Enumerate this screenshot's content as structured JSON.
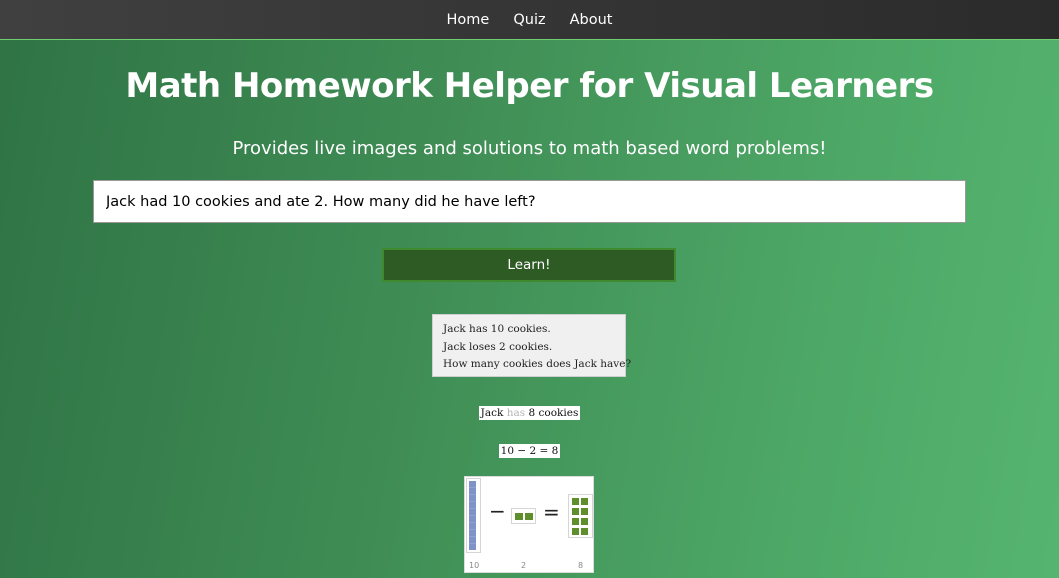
{
  "nav": {
    "items": [
      {
        "label": "Home"
      },
      {
        "label": "Quiz"
      },
      {
        "label": "About"
      }
    ]
  },
  "hero": {
    "title": "Math Homework Helper for Visual Learners",
    "subtitle": "Provides live images and solutions to math based word problems!"
  },
  "input": {
    "value": "Jack had 10 cookies and ate 2. How many did he have left?"
  },
  "learn_button": {
    "label": "Learn!"
  },
  "steps": [
    "Jack has 10 cookies.",
    "Jack loses 2 cookies.",
    "How many cookies does Jack have?"
  ],
  "answer": {
    "subject": "Jack",
    "verb": "has",
    "rest": "8 cookies"
  },
  "equation": "10 − 2 = 8",
  "visual": {
    "start": "10",
    "subtract": "2",
    "result": "8",
    "colors": {
      "tens": "#7f93c9",
      "units": "#5f8f2c"
    }
  },
  "colors": {
    "navbar": "#333333",
    "button_bg": "#2e5a24",
    "gradient_start": "#2f7345",
    "gradient_end": "#55b570"
  }
}
